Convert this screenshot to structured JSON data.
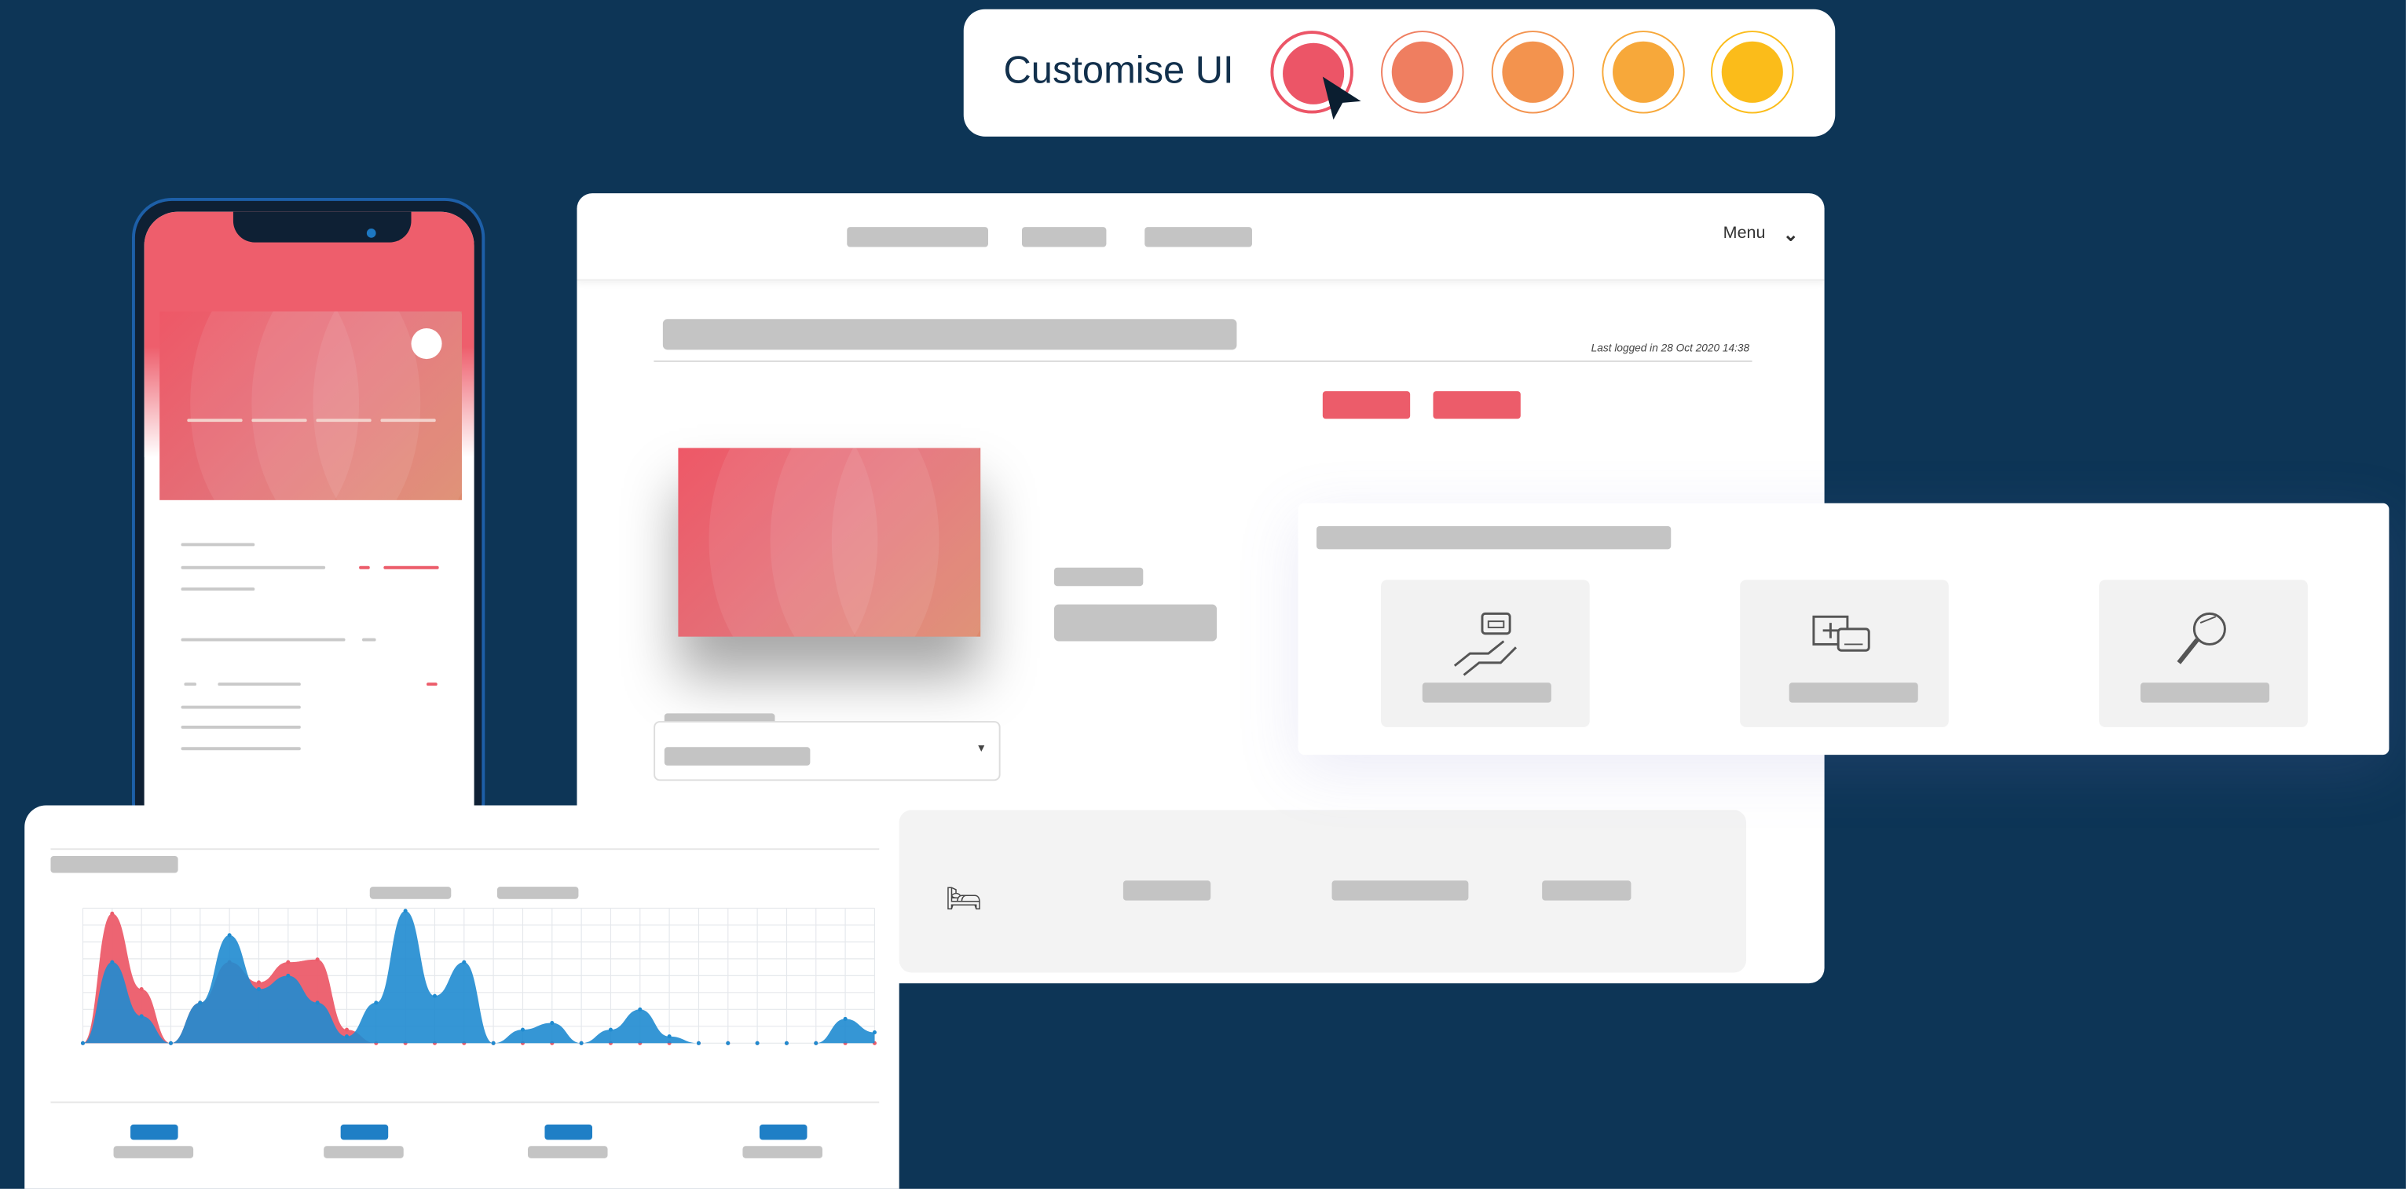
{
  "customise": {
    "title": "Customise UI",
    "swatches": [
      "#ec5567",
      "#ef7e60",
      "#f3934e",
      "#f7a83a",
      "#fbbc1a"
    ],
    "selected_index": 0
  },
  "desktop": {
    "menu_label": "Menu",
    "last_logged": "Last logged in 28 Oct 2020 14:38"
  },
  "features": {
    "icons": [
      "hand-card-icon",
      "add-card-icon",
      "magnifier-icon"
    ]
  },
  "chart_data": {
    "type": "area",
    "title": "",
    "xlabel": "",
    "ylabel": "",
    "x": [
      0,
      1,
      2,
      3,
      4,
      5,
      6,
      7,
      8,
      9,
      10,
      11,
      12,
      13,
      14,
      15,
      16,
      17,
      18,
      19,
      20,
      21,
      22,
      23,
      24,
      25,
      26,
      27
    ],
    "ylim": [
      0,
      100
    ],
    "series": [
      {
        "color": "#ec5c6a",
        "values": [
          0,
          96,
          40,
          0,
          30,
          60,
          45,
          60,
          62,
          10,
          0,
          0,
          0,
          0,
          0,
          0,
          0,
          0,
          0,
          0,
          0,
          0,
          0,
          0,
          0,
          0,
          0,
          0
        ]
      },
      {
        "color": "#1f8bd0",
        "values": [
          0,
          60,
          20,
          0,
          30,
          80,
          40,
          50,
          30,
          5,
          30,
          98,
          35,
          60,
          0,
          10,
          15,
          0,
          10,
          25,
          5,
          0,
          0,
          0,
          0,
          0,
          18,
          8
        ]
      }
    ]
  },
  "colors": {
    "background": "#0d3556",
    "accent": "#ec5c6a",
    "chart_blue": "#1f8bd0"
  }
}
